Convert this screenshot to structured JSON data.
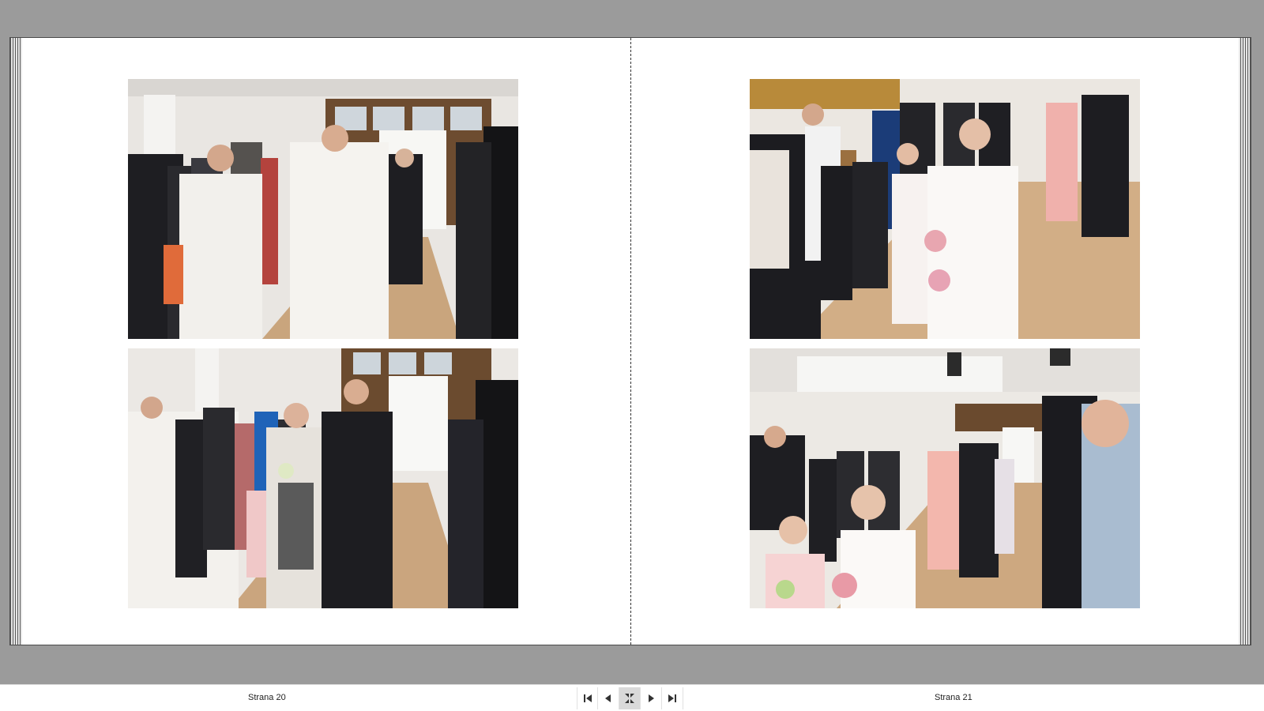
{
  "pages": {
    "left": {
      "label": "Strana 20"
    },
    "right": {
      "label": "Strana 21"
    }
  },
  "navigation": {
    "buttons": [
      "first-page-icon",
      "previous-page-icon",
      "fit-view-icon",
      "next-page-icon",
      "last-page-icon"
    ]
  },
  "colors": {
    "viewer_background": "#9b9b9b",
    "page_background": "#ffffff",
    "floor": "#c9a57d",
    "suit": "#1e1e22",
    "white_robe": "#f2f0ec",
    "pink_dress": "#f1b3b0"
  }
}
